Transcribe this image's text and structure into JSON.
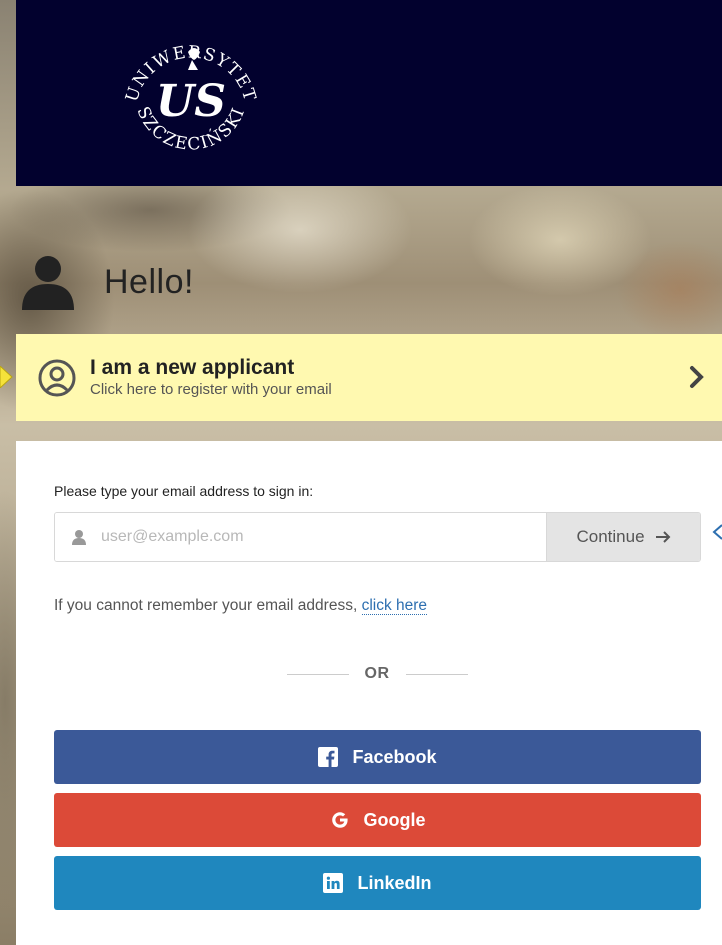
{
  "header": {
    "logo_text_top": "UNIWERSYTET",
    "logo_text_bottom": "SZCZECIŃSKI",
    "logo_monogram": "US"
  },
  "hello": {
    "text": "Hello!"
  },
  "applicant": {
    "title": "I am a new applicant",
    "subtitle": "Click here to register with your email"
  },
  "signin": {
    "label": "Please type your email address to sign in:",
    "email_placeholder": "user@example.com",
    "email_value": "",
    "continue_label": "Continue"
  },
  "forgot": {
    "text": "If you cannot remember your email address, ",
    "link": "click here"
  },
  "divider": {
    "text": "OR"
  },
  "social": {
    "facebook": "Facebook",
    "google": "Google",
    "linkedin": "LinkedIn"
  },
  "colors": {
    "header_bg": "#02012e",
    "applicant_bg": "#fff9b0",
    "link": "#2d6fb0",
    "facebook": "#3b5998",
    "google": "#dc4a38",
    "linkedin": "#1f87be"
  }
}
